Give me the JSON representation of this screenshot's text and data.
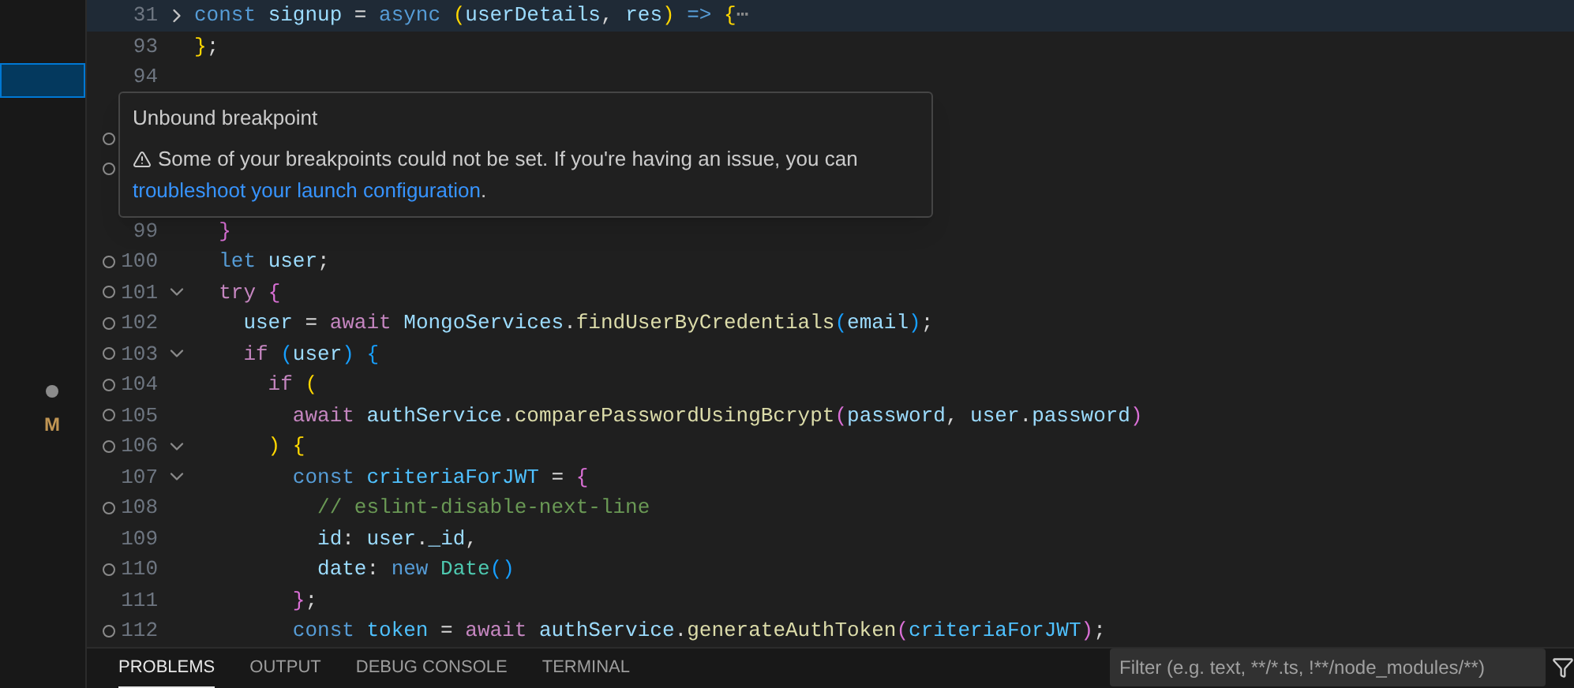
{
  "sidebar": {
    "items": [
      {
        "kind": "row",
        "selected": true
      },
      {
        "kind": "dot"
      },
      {
        "kind": "letter",
        "text": "M"
      }
    ]
  },
  "editor": {
    "lines": [
      {
        "number": "31",
        "breakpoint": false,
        "expanded": false,
        "sticky": true,
        "tokens": [
          {
            "text": "const ",
            "kind": "kw"
          },
          {
            "text": "signup",
            "kind": "var"
          },
          {
            "text": " = ",
            "kind": "plain"
          },
          {
            "text": "async ",
            "kind": "kw"
          },
          {
            "text": "(",
            "kind": "b1"
          },
          {
            "text": "userDetails",
            "kind": "var"
          },
          {
            "text": ", ",
            "kind": "plain"
          },
          {
            "text": "res",
            "kind": "var"
          },
          {
            "text": ") ",
            "kind": "b1"
          },
          {
            "text": "=> ",
            "kind": "kw"
          },
          {
            "text": "{",
            "kind": "b1"
          },
          {
            "text": "⋯",
            "kind": "dim"
          }
        ]
      },
      {
        "number": "93",
        "breakpoint": false,
        "tokens": [
          {
            "text": "}",
            "kind": "b1"
          },
          {
            "text": ";",
            "kind": "plain"
          }
        ]
      },
      {
        "number": "94",
        "breakpoint": false
      },
      {
        "breakpoint": false
      },
      {
        "breakpoint": true
      },
      {
        "breakpoint": true
      },
      {
        "breakpoint": false
      },
      {
        "number": "99",
        "breakpoint": false,
        "tokens": [
          {
            "text": "  }",
            "kind": "b2"
          }
        ]
      },
      {
        "number": "100",
        "breakpoint": true,
        "tokens": [
          {
            "text": "  let ",
            "kind": "kw"
          },
          {
            "text": "user",
            "kind": "var"
          },
          {
            "text": ";",
            "kind": "plain"
          }
        ]
      },
      {
        "number": "101",
        "breakpoint": true,
        "expanded": true,
        "tokens": [
          {
            "text": "  try ",
            "kind": "ctrl"
          },
          {
            "text": "{",
            "kind": "b2"
          }
        ]
      },
      {
        "number": "102",
        "breakpoint": true,
        "tokens": [
          {
            "text": "    user",
            "kind": "var"
          },
          {
            "text": " = ",
            "kind": "plain"
          },
          {
            "text": "await ",
            "kind": "ctrl"
          },
          {
            "text": "MongoServices",
            "kind": "var"
          },
          {
            "text": ".",
            "kind": "plain"
          },
          {
            "text": "findUserByCredentials",
            "kind": "fn"
          },
          {
            "text": "(",
            "kind": "b3"
          },
          {
            "text": "email",
            "kind": "var"
          },
          {
            "text": ")",
            "kind": "b3"
          },
          {
            "text": ";",
            "kind": "plain"
          }
        ]
      },
      {
        "number": "103",
        "breakpoint": true,
        "expanded": true,
        "tokens": [
          {
            "text": "    if ",
            "kind": "ctrl"
          },
          {
            "text": "(",
            "kind": "b3"
          },
          {
            "text": "user",
            "kind": "var"
          },
          {
            "text": ") {",
            "kind": "b3"
          }
        ]
      },
      {
        "number": "104",
        "breakpoint": true,
        "tokens": [
          {
            "text": "      if ",
            "kind": "ctrl"
          },
          {
            "text": "(",
            "kind": "b1"
          }
        ]
      },
      {
        "number": "105",
        "breakpoint": true,
        "tokens": [
          {
            "text": "        await ",
            "kind": "ctrl"
          },
          {
            "text": "authService",
            "kind": "var"
          },
          {
            "text": ".",
            "kind": "plain"
          },
          {
            "text": "comparePasswordUsingBcrypt",
            "kind": "fn"
          },
          {
            "text": "(",
            "kind": "b2"
          },
          {
            "text": "password",
            "kind": "var"
          },
          {
            "text": ", ",
            "kind": "plain"
          },
          {
            "text": "user",
            "kind": "var"
          },
          {
            "text": ".",
            "kind": "plain"
          },
          {
            "text": "password",
            "kind": "var"
          },
          {
            "text": ")",
            "kind": "b2"
          }
        ]
      },
      {
        "number": "106",
        "breakpoint": true,
        "expanded": true,
        "tokens": [
          {
            "text": "      ) {",
            "kind": "b1"
          }
        ]
      },
      {
        "number": "107",
        "breakpoint": false,
        "expanded": true,
        "tokens": [
          {
            "text": "        const ",
            "kind": "kw"
          },
          {
            "text": "criteriaForJWT",
            "kind": "cst"
          },
          {
            "text": " = ",
            "kind": "plain"
          },
          {
            "text": "{",
            "kind": "b2"
          }
        ]
      },
      {
        "number": "108",
        "breakpoint": true,
        "tokens": [
          {
            "text": "          // eslint-disable-next-line",
            "kind": "comment"
          }
        ]
      },
      {
        "number": "109",
        "breakpoint": false,
        "tokens": [
          {
            "text": "          id",
            "kind": "var"
          },
          {
            "text": ": ",
            "kind": "plain"
          },
          {
            "text": "user",
            "kind": "var"
          },
          {
            "text": ".",
            "kind": "plain"
          },
          {
            "text": "_id",
            "kind": "var"
          },
          {
            "text": ",",
            "kind": "plain"
          }
        ]
      },
      {
        "number": "110",
        "breakpoint": true,
        "tokens": [
          {
            "text": "          date",
            "kind": "var"
          },
          {
            "text": ": ",
            "kind": "plain"
          },
          {
            "text": "new ",
            "kind": "kw"
          },
          {
            "text": "Date",
            "kind": "cls"
          },
          {
            "text": "()",
            "kind": "b3"
          }
        ]
      },
      {
        "number": "111",
        "breakpoint": false,
        "tokens": [
          {
            "text": "        }",
            "kind": "b2"
          },
          {
            "text": ";",
            "kind": "plain"
          }
        ]
      },
      {
        "number": "112",
        "breakpoint": true,
        "tokens": [
          {
            "text": "        const ",
            "kind": "kw"
          },
          {
            "text": "token",
            "kind": "cst"
          },
          {
            "text": " = ",
            "kind": "plain"
          },
          {
            "text": "await ",
            "kind": "ctrl"
          },
          {
            "text": "authService",
            "kind": "var"
          },
          {
            "text": ".",
            "kind": "plain"
          },
          {
            "text": "generateAuthToken",
            "kind": "fn"
          },
          {
            "text": "(",
            "kind": "b2"
          },
          {
            "text": "criteriaForJWT",
            "kind": "cst"
          },
          {
            "text": ")",
            "kind": "b2"
          },
          {
            "text": ";",
            "kind": "plain"
          }
        ]
      }
    ]
  },
  "tooltip": {
    "title": "Unbound breakpoint",
    "message": "Some of your breakpoints could not be set. If you're having an issue, you can",
    "link": "troubleshoot your launch configuration",
    "suffix": "."
  },
  "panel": {
    "tabs": [
      {
        "label": "PROBLEMS",
        "selected": true
      },
      {
        "label": "OUTPUT",
        "selected": false
      },
      {
        "label": "DEBUG CONSOLE",
        "selected": false
      },
      {
        "label": "TERMINAL",
        "selected": false
      }
    ],
    "filter": {
      "placeholder": "Filter (e.g. text, **/*.ts, !**/node_modules/**)"
    }
  }
}
